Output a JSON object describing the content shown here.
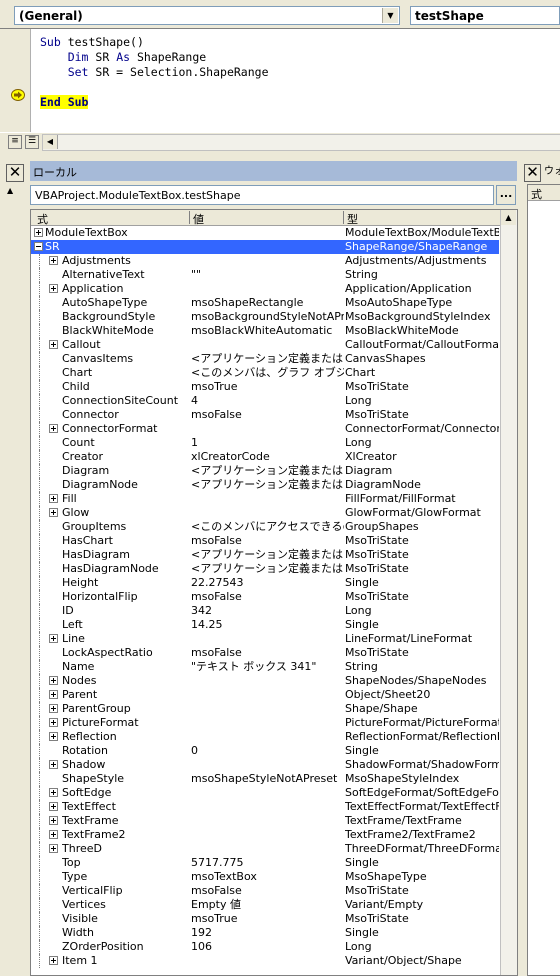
{
  "code_window": {
    "object_combo": "(General)",
    "proc_combo": "testShape",
    "lines": [
      {
        "parts": [
          {
            "t": "Sub",
            "k": "kw"
          },
          {
            "t": " testShape()",
            "k": ""
          }
        ]
      },
      {
        "parts": [
          {
            "t": "    ",
            "k": ""
          },
          {
            "t": "Dim",
            "k": "kw"
          },
          {
            "t": " SR ",
            "k": ""
          },
          {
            "t": "As",
            "k": "kw"
          },
          {
            "t": " ShapeRange",
            "k": ""
          }
        ]
      },
      {
        "parts": [
          {
            "t": "    ",
            "k": ""
          },
          {
            "t": "Set",
            "k": "kw"
          },
          {
            "t": " SR = Selection.ShapeRange",
            "k": ""
          }
        ]
      },
      {
        "parts": []
      },
      {
        "parts": [
          {
            "t": "End Sub",
            "k": "hl"
          }
        ]
      }
    ]
  },
  "locals": {
    "title": "ローカル",
    "context": "VBAProject.ModuleTextBox.testShape",
    "context_button": "...",
    "headers": {
      "expr": "式",
      "value": "値",
      "type": "型"
    },
    "rows": [
      {
        "name": "ModuleTextBox",
        "value": "",
        "type": "ModuleTextBox/ModuleTextBox",
        "exp": "plus",
        "level": 0
      },
      {
        "name": "SR",
        "value": "",
        "type": "ShapeRange/ShapeRange",
        "exp": "minus",
        "level": 0,
        "selected": true
      },
      {
        "name": "Adjustments",
        "value": "",
        "type": "Adjustments/Adjustments",
        "exp": "plus",
        "level": 1
      },
      {
        "name": "AlternativeText",
        "value": "\"\"",
        "type": "String",
        "exp": "",
        "level": 1
      },
      {
        "name": "Application",
        "value": "",
        "type": "Application/Application",
        "exp": "plus",
        "level": 1
      },
      {
        "name": "AutoShapeType",
        "value": "msoShapeRectangle",
        "type": "MsoAutoShapeType",
        "exp": "",
        "level": 1
      },
      {
        "name": "BackgroundStyle",
        "value": "msoBackgroundStyleNotAPreset",
        "type": "MsoBackgroundStyleIndex",
        "exp": "",
        "level": 1
      },
      {
        "name": "BlackWhiteMode",
        "value": "msoBlackWhiteAutomatic",
        "type": "MsoBlackWhiteMode",
        "exp": "",
        "level": 1
      },
      {
        "name": "Callout",
        "value": "",
        "type": "CalloutFormat/CalloutFormat",
        "exp": "plus",
        "level": 1
      },
      {
        "name": "CanvasItems",
        "value": "<アプリケーション定義またはオブジェクト定義のエラーです。>",
        "type": "CanvasShapes",
        "exp": "",
        "level": 1
      },
      {
        "name": "Chart",
        "value": "<このメンバは、グラフ オブジェクトに対してのみ使用できます。>",
        "type": "Chart",
        "exp": "",
        "level": 1
      },
      {
        "name": "Child",
        "value": "msoTrue",
        "type": "MsoTriState",
        "exp": "",
        "level": 1
      },
      {
        "name": "ConnectionSiteCount",
        "value": "4",
        "type": "Long",
        "exp": "",
        "level": 1
      },
      {
        "name": "Connector",
        "value": "msoFalse",
        "type": "MsoTriState",
        "exp": "",
        "level": 1
      },
      {
        "name": "ConnectorFormat",
        "value": "",
        "type": "ConnectorFormat/ConnectorFormat",
        "exp": "plus",
        "level": 1
      },
      {
        "name": "Count",
        "value": "1",
        "type": "Long",
        "exp": "",
        "level": 1
      },
      {
        "name": "Creator",
        "value": "xlCreatorCode",
        "type": "XlCreator",
        "exp": "",
        "level": 1
      },
      {
        "name": "Diagram",
        "value": "<アプリケーション定義またはオブジェクト定義のエラーです。>",
        "type": "Diagram",
        "exp": "",
        "level": 1
      },
      {
        "name": "DiagramNode",
        "value": "<アプリケーション定義またはオブジェクト定義のエラーです。>",
        "type": "DiagramNode",
        "exp": "",
        "level": 1
      },
      {
        "name": "Fill",
        "value": "",
        "type": "FillFormat/FillFormat",
        "exp": "plus",
        "level": 1
      },
      {
        "name": "Glow",
        "value": "",
        "type": "GlowFormat/GlowFormat",
        "exp": "plus",
        "level": 1
      },
      {
        "name": "GroupItems",
        "value": "<このメンバにアクセスできるのはグループだけです。>",
        "type": "GroupShapes",
        "exp": "",
        "level": 1
      },
      {
        "name": "HasChart",
        "value": "msoFalse",
        "type": "MsoTriState",
        "exp": "",
        "level": 1
      },
      {
        "name": "HasDiagram",
        "value": "<アプリケーション定義またはオブジェクト定義のエラーです。>",
        "type": "MsoTriState",
        "exp": "",
        "level": 1
      },
      {
        "name": "HasDiagramNode",
        "value": "<アプリケーション定義またはオブジェクト定義のエラーです。>",
        "type": "MsoTriState",
        "exp": "",
        "level": 1
      },
      {
        "name": "Height",
        "value": "22.27543",
        "type": "Single",
        "exp": "",
        "level": 1
      },
      {
        "name": "HorizontalFlip",
        "value": "msoFalse",
        "type": "MsoTriState",
        "exp": "",
        "level": 1
      },
      {
        "name": "ID",
        "value": "342",
        "type": "Long",
        "exp": "",
        "level": 1
      },
      {
        "name": "Left",
        "value": "14.25",
        "type": "Single",
        "exp": "",
        "level": 1
      },
      {
        "name": "Line",
        "value": "",
        "type": "LineFormat/LineFormat",
        "exp": "plus",
        "level": 1
      },
      {
        "name": "LockAspectRatio",
        "value": "msoFalse",
        "type": "MsoTriState",
        "exp": "",
        "level": 1
      },
      {
        "name": "Name",
        "value": "\"テキスト ボックス 341\"",
        "type": "String",
        "exp": "",
        "level": 1
      },
      {
        "name": "Nodes",
        "value": "",
        "type": "ShapeNodes/ShapeNodes",
        "exp": "plus",
        "level": 1
      },
      {
        "name": "Parent",
        "value": "",
        "type": "Object/Sheet20",
        "exp": "plus",
        "level": 1
      },
      {
        "name": "ParentGroup",
        "value": "",
        "type": "Shape/Shape",
        "exp": "plus",
        "level": 1
      },
      {
        "name": "PictureFormat",
        "value": "",
        "type": "PictureFormat/PictureFormat",
        "exp": "plus",
        "level": 1
      },
      {
        "name": "Reflection",
        "value": "",
        "type": "ReflectionFormat/ReflectionFormat",
        "exp": "plus",
        "level": 1
      },
      {
        "name": "Rotation",
        "value": "0",
        "type": "Single",
        "exp": "",
        "level": 1
      },
      {
        "name": "Shadow",
        "value": "",
        "type": "ShadowFormat/ShadowFormat",
        "exp": "plus",
        "level": 1
      },
      {
        "name": "ShapeStyle",
        "value": "msoShapeStyleNotAPreset",
        "type": "MsoShapeStyleIndex",
        "exp": "",
        "level": 1
      },
      {
        "name": "SoftEdge",
        "value": "",
        "type": "SoftEdgeFormat/SoftEdgeFormat",
        "exp": "plus",
        "level": 1
      },
      {
        "name": "TextEffect",
        "value": "",
        "type": "TextEffectFormat/TextEffectFormat",
        "exp": "plus",
        "level": 1
      },
      {
        "name": "TextFrame",
        "value": "",
        "type": "TextFrame/TextFrame",
        "exp": "plus",
        "level": 1
      },
      {
        "name": "TextFrame2",
        "value": "",
        "type": "TextFrame2/TextFrame2",
        "exp": "plus",
        "level": 1
      },
      {
        "name": "ThreeD",
        "value": "",
        "type": "ThreeDFormat/ThreeDFormat",
        "exp": "plus",
        "level": 1
      },
      {
        "name": "Top",
        "value": "5717.775",
        "type": "Single",
        "exp": "",
        "level": 1
      },
      {
        "name": "Type",
        "value": "msoTextBox",
        "type": "MsoShapeType",
        "exp": "",
        "level": 1
      },
      {
        "name": "VerticalFlip",
        "value": "msoFalse",
        "type": "MsoTriState",
        "exp": "",
        "level": 1
      },
      {
        "name": "Vertices",
        "value": "Empty 値",
        "type": "Variant/Empty",
        "exp": "",
        "level": 1
      },
      {
        "name": "Visible",
        "value": "msoTrue",
        "type": "MsoTriState",
        "exp": "",
        "level": 1
      },
      {
        "name": "Width",
        "value": "192",
        "type": "Single",
        "exp": "",
        "level": 1
      },
      {
        "name": "ZOrderPosition",
        "value": "106",
        "type": "Long",
        "exp": "",
        "level": 1
      },
      {
        "name": "Item 1",
        "value": "",
        "type": "Variant/Object/Shape",
        "exp": "plus",
        "level": 1
      }
    ]
  },
  "watch": {
    "title": "ウォッチ",
    "header": "式"
  }
}
